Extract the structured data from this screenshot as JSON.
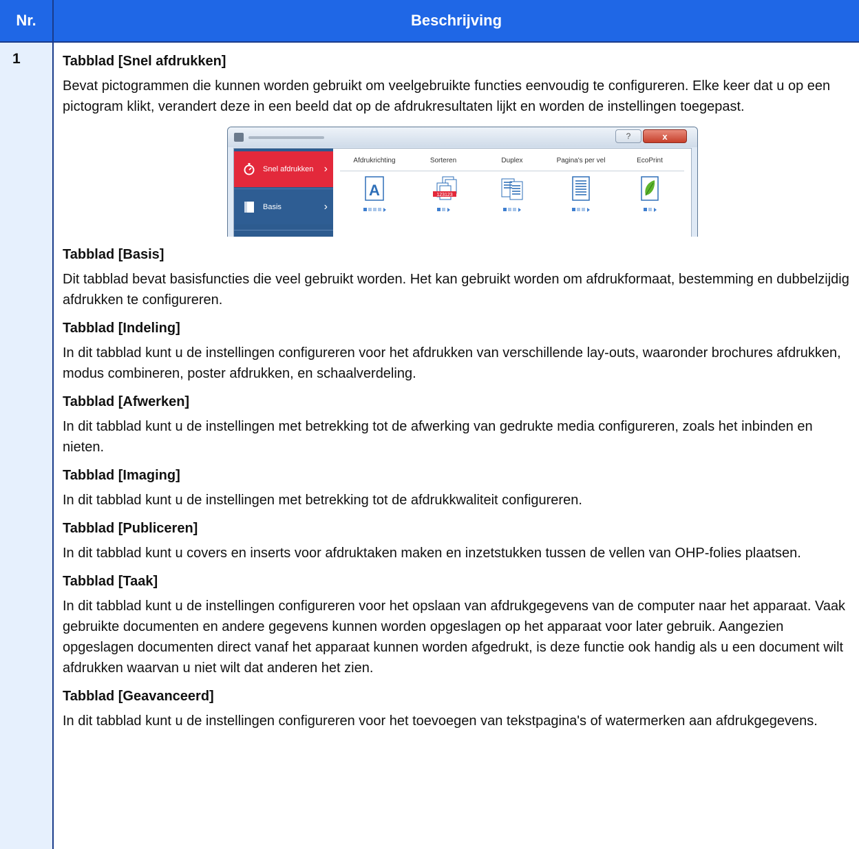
{
  "table": {
    "header_nr": "Nr.",
    "header_desc": "Beschrijving",
    "row_number": "1"
  },
  "sections": [
    {
      "title": "Tabblad [Snel afdrukken]",
      "body": "Bevat pictogrammen die kunnen worden gebruikt om veelgebruikte functies eenvoudig te configureren. Elke keer dat u op een pictogram klikt, verandert deze in een beeld dat op de afdrukresultaten lijkt en worden de instellingen toegepast."
    },
    {
      "title": "Tabblad [Basis]",
      "body": "Dit tabblad bevat basisfuncties die veel gebruikt worden. Het kan gebruikt worden om afdrukformaat, bestemming en dubbelzijdig afdrukken te configureren."
    },
    {
      "title": "Tabblad [Indeling]",
      "body": "In dit tabblad kunt u de instellingen configureren voor het afdrukken van verschillende lay-outs, waaronder brochures afdrukken, modus combineren, poster afdrukken, en schaalverdeling."
    },
    {
      "title": "Tabblad [Afwerken]",
      "body": "In dit tabblad kunt u de instellingen met betrekking tot de afwerking van gedrukte media configureren, zoals het inbinden en nieten."
    },
    {
      "title": "Tabblad [Imaging]",
      "body": "In dit tabblad kunt u de instellingen met betrekking tot de afdrukkwaliteit configureren."
    },
    {
      "title": "Tabblad [Publiceren]",
      "body": "In dit tabblad kunt u covers en inserts voor afdruktaken maken en inzetstukken tussen de vellen van OHP-folies plaatsen."
    },
    {
      "title": "Tabblad [Taak]",
      "body": "In dit tabblad kunt u de instellingen configureren voor het opslaan van afdrukgegevens van de computer naar het apparaat. Vaak gebruikte documenten en andere gegevens kunnen worden opgeslagen op het apparaat voor later gebruik. Aangezien opgeslagen documenten direct vanaf het apparaat kunnen worden afgedrukt, is deze functie ook handig als u een document wilt afdrukken waarvan u niet wilt dat anderen het zien."
    },
    {
      "title": "Tabblad [Geavanceerd]",
      "body": "In dit tabblad kunt u de instellingen configureren voor het toevoegen van tekstpagina's of watermerken aan afdrukgegevens."
    }
  ],
  "screenshot": {
    "help_button": "?",
    "close_button": "x",
    "sidebar": [
      {
        "label": "Snel afdrukken",
        "icon": "stopwatch-icon"
      },
      {
        "label": "Basis",
        "icon": "page-icon"
      }
    ],
    "columns": [
      {
        "label": "Afdrukrichting",
        "icon": "orientation-icon"
      },
      {
        "label": "Sorteren",
        "icon": "collate-icon"
      },
      {
        "label": "Duplex",
        "icon": "duplex-icon"
      },
      {
        "label": "Pagina's per vel",
        "icon": "pages-per-sheet-icon"
      },
      {
        "label": "EcoPrint",
        "icon": "ecoprint-leaf-icon"
      }
    ],
    "orientation_letter": "A",
    "collate_text": "123123",
    "colors": {
      "active_tab": "#e3293b",
      "sidebar": "#2d5b8f",
      "header": "#1f67e6"
    }
  }
}
